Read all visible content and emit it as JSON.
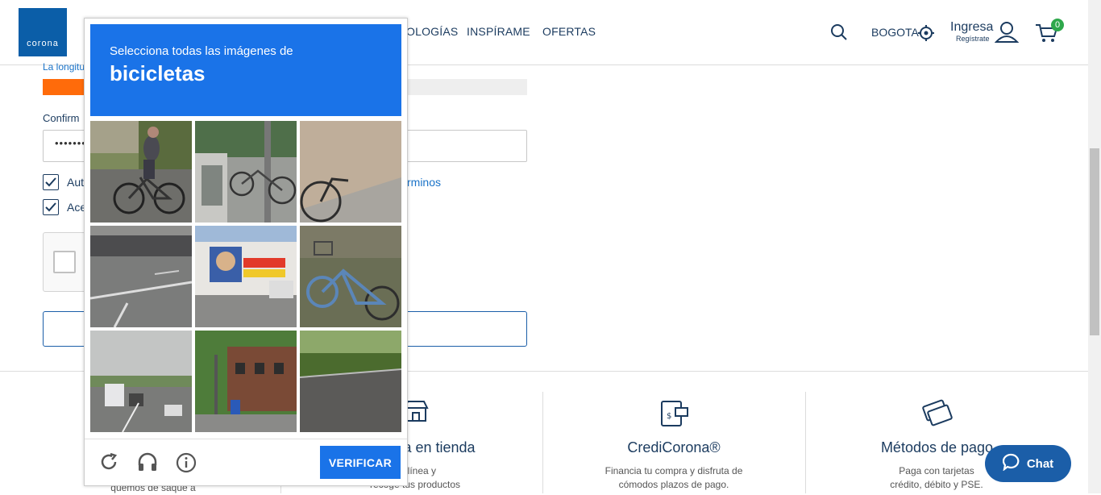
{
  "header": {
    "logo_text": "corona",
    "nav": [
      "OLOGÍAS",
      "INSPÍRAME",
      "OFERTAS"
    ],
    "city": "BOGOTA",
    "login": "Ingresa",
    "register": "Regístrate",
    "cart_count": "0"
  },
  "form": {
    "length_hint": "La longitu",
    "confirm_label": "Confirm",
    "password_dots": "••••••••",
    "checkbox_1_text": "Aut",
    "checkbox_2_text": "Ace",
    "terms_link": "rminos"
  },
  "footer": {
    "col1_text": "quémos de saqué a",
    "col2_title": "a en tienda",
    "col2_text_line1": "en línea y",
    "col2_text_line2": "recoge tus productos",
    "col3_title": "CrediCorona®",
    "col3_text_line1": "Financia tu compra y disfruta de",
    "col3_text_line2": "cómodos plazos de pago.",
    "col4_title": "Métodos de pago",
    "col4_text_line1": "Paga con tarjetas",
    "col4_text_line2": "crédito, débito y PSE."
  },
  "chat": {
    "label": "Chat"
  },
  "captcha": {
    "instruction": "Selecciona todas las imágenes de",
    "target": "bicicletas",
    "verify_label": "VERIFICAR",
    "tiles": [
      {
        "subject": "cyclist-on-road"
      },
      {
        "subject": "parked-bicycles"
      },
      {
        "subject": "bicycle-by-wall"
      },
      {
        "subject": "street-road"
      },
      {
        "subject": "storefront-sign"
      },
      {
        "subject": "blue-bicycle"
      },
      {
        "subject": "highway-traffic"
      },
      {
        "subject": "tree-lined-street"
      },
      {
        "subject": "park-road"
      }
    ]
  },
  "colors": {
    "brand_blue": "#0b5ea8",
    "captcha_blue": "#1a73e8",
    "strength_orange": "#ff6b0a",
    "badge_green": "#2ea84b"
  }
}
